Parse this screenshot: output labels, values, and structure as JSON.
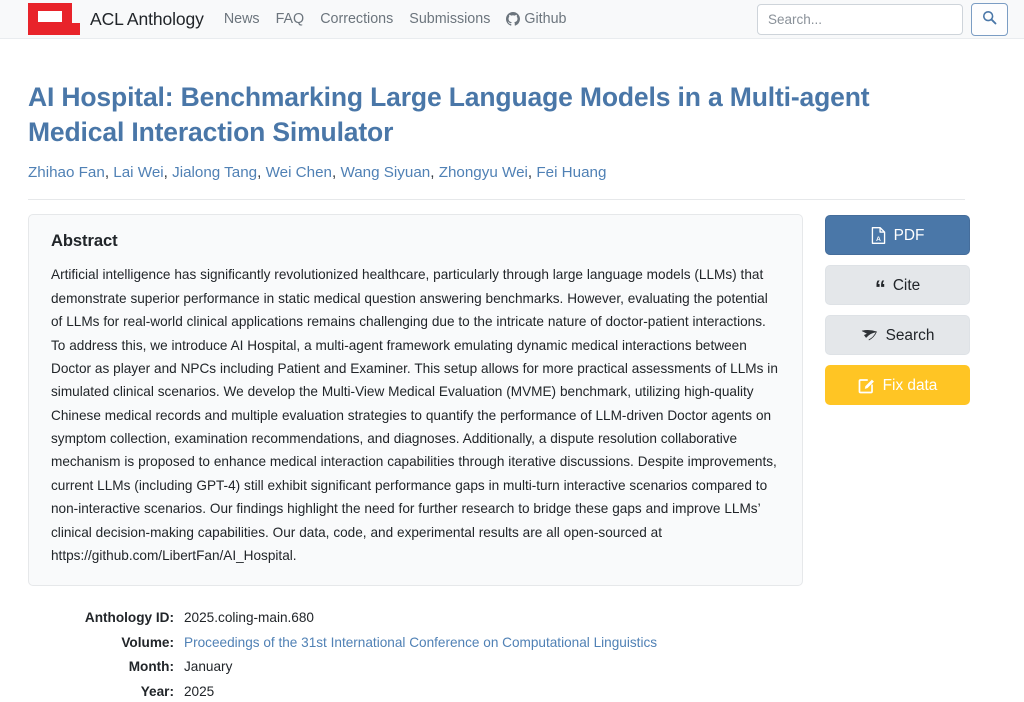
{
  "header": {
    "brand": "ACL Anthology",
    "logo_icon": "acl-logo-icon",
    "nav": [
      {
        "label": "News"
      },
      {
        "label": "FAQ"
      },
      {
        "label": "Corrections"
      },
      {
        "label": "Submissions"
      },
      {
        "label": "Github",
        "icon": "github-icon"
      }
    ],
    "search": {
      "placeholder": "Search...",
      "value": "",
      "button_icon": "search-icon"
    },
    "colors": {
      "logo_red": "#e8232a",
      "background": "#f8f9fa",
      "nav_text": "#6c757d"
    }
  },
  "paper": {
    "title": "AI Hospital: Benchmarking Large Language Models in a Multi-agent Medical Interaction Simulator",
    "authors": [
      "Zhihao Fan",
      "Lai Wei",
      "Jialong Tang",
      "Wei Chen",
      "Wang Siyuan",
      "Zhongyu Wei",
      "Fei Huang"
    ],
    "abstract_heading": "Abstract",
    "abstract": "Artificial intelligence has significantly revolutionized healthcare, particularly through large language models (LLMs) that demonstrate superior performance in static medical question answering benchmarks. However, evaluating the potential of LLMs for real-world clinical applications remains challenging due to the intricate nature of doctor-patient interactions. To address this, we introduce AI Hospital, a multi-agent framework emulating dynamic medical interactions between Doctor as player and NPCs including Patient and Examiner. This setup allows for more practical assessments of LLMs in simulated clinical scenarios. We develop the Multi-View Medical Evaluation (MVME) benchmark, utilizing high-quality Chinese medical records and multiple evaluation strategies to quantify the performance of LLM-driven Doctor agents on symptom collection, examination recommendations, and diagnoses. Additionally, a dispute resolution collaborative mechanism is proposed to enhance medical interaction capabilities through iterative discussions. Despite improvements, current LLMs (including GPT-4) still exhibit significant performance gaps in multi-turn interactive scenarios compared to non-interactive scenarios. Our findings highlight the need for further research to bridge these gaps and improve LLMs’ clinical decision-making capabilities. Our data, code, and experimental results are all open-sourced at https://github.com/LibertFan/AI_Hospital."
  },
  "actions": [
    {
      "label": "PDF",
      "icon": "file-pdf-icon",
      "color": "#4a77a8"
    },
    {
      "label": "Cite",
      "icon": "quote-left-icon",
      "color": "#e4e7ea"
    },
    {
      "label": "Search",
      "icon": "semantic-scholar-icon",
      "color": "#e4e7ea"
    },
    {
      "label": "Fix data",
      "icon": "pen-square-icon",
      "color": "#ffc524"
    }
  ],
  "metadata": [
    {
      "key": "Anthology ID:",
      "value": "2025.coling-main.680",
      "is_link": false
    },
    {
      "key": "Volume:",
      "value": "Proceedings of the 31st International Conference on Computational Linguistics",
      "is_link": true
    },
    {
      "key": "Month:",
      "value": "January",
      "is_link": false
    },
    {
      "key": "Year:",
      "value": "2025",
      "is_link": false
    }
  ]
}
